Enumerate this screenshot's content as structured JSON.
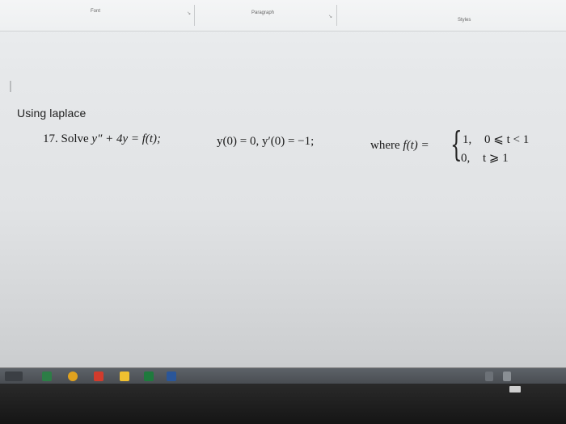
{
  "ribbon": {
    "font_label": "Font",
    "paragraph_label": "Paragraph",
    "styles_label": "Styles",
    "launcher_glyph": "↘"
  },
  "document": {
    "heading": "Using laplace",
    "problem_number": "17.",
    "solve_word": "Solve",
    "equation": "y″ + 4y = f(t);",
    "initial_conditions": "y(0) = 0, y′(0) = −1;",
    "where_word": "where",
    "function_lhs": "f(t) =",
    "cases": [
      {
        "value": "1,",
        "condition": "0 ⩽ t < 1"
      },
      {
        "value": "0,",
        "condition": "t ⩾ 1"
      }
    ]
  },
  "taskbar": {
    "colors": {
      "start": "#2d7d46",
      "chrome": "#e0a21f",
      "acrobat": "#d23b2c",
      "explorer": "#f0c030",
      "excel": "#1f7a3d",
      "word": "#2a5699"
    },
    "icons": [
      "start-icon",
      "chrome-icon",
      "acrobat-icon",
      "file-explorer-icon",
      "excel-icon",
      "word-icon"
    ]
  }
}
